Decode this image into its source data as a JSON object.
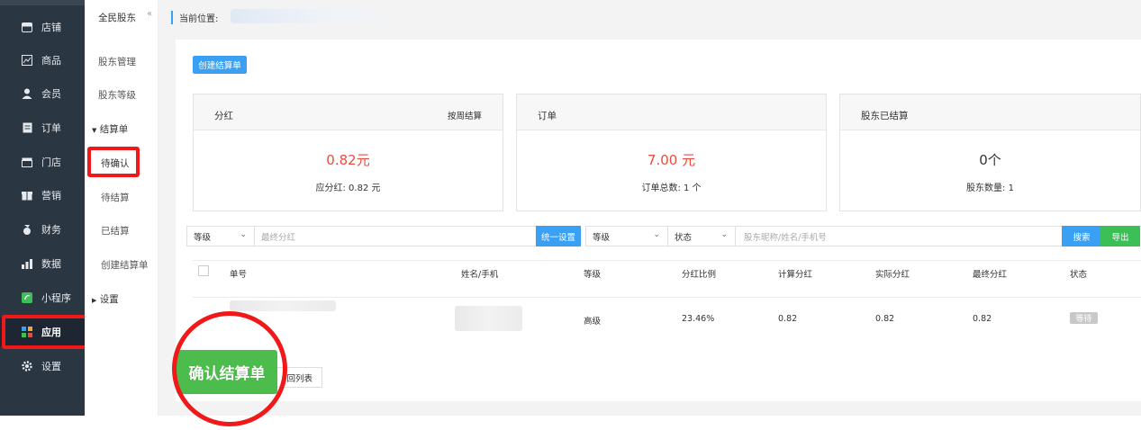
{
  "sidebar": {
    "items": [
      {
        "label": "店铺",
        "icon": "store-icon"
      },
      {
        "label": "商品",
        "icon": "goods-icon"
      },
      {
        "label": "会员",
        "icon": "member-icon"
      },
      {
        "label": "订单",
        "icon": "order-icon"
      },
      {
        "label": "门店",
        "icon": "shop-icon"
      },
      {
        "label": "营销",
        "icon": "marketing-icon"
      },
      {
        "label": "财务",
        "icon": "finance-icon"
      },
      {
        "label": "数据",
        "icon": "data-icon"
      },
      {
        "label": "小程序",
        "icon": "miniprogram-icon"
      },
      {
        "label": "应用",
        "icon": "apps-icon"
      },
      {
        "label": "设置",
        "icon": "gear-icon"
      }
    ]
  },
  "subnav": {
    "title": "全民股东",
    "items": [
      "股东管理",
      "股东等级"
    ],
    "group_settlement": "结算单",
    "settlement_items": [
      "待确认",
      "待结算",
      "已结算",
      "创建结算单"
    ],
    "group_settings": "设置"
  },
  "breadcrumb": {
    "label": "当前位置:"
  },
  "create_button": "创建结算单",
  "cards": [
    {
      "title": "分红",
      "right": "按周结算",
      "big": "0.82元",
      "small": "应分红: 0.82 元",
      "big_color": "#e84c3d"
    },
    {
      "title": "订单",
      "right": "",
      "big": "7.00 元",
      "small": "订单总数: 1 个",
      "big_color": "#e84c3d"
    },
    {
      "title": "股东已结算",
      "right": "",
      "big": "0个",
      "small": "股东数量: 1",
      "big_color": "#333333"
    }
  ],
  "filters": {
    "level1": "等级",
    "final_dividend_placeholder": "最终分红",
    "unify_button": "统一设置",
    "level2": "等级",
    "status": "状态",
    "search_placeholder": "股东昵称/姓名/手机号",
    "search_button": "搜索",
    "export_button": "导出"
  },
  "table": {
    "headers": [
      "单号",
      "姓名/手机",
      "等级",
      "分红比例",
      "计算分红",
      "实际分红",
      "最终分红",
      "状态"
    ],
    "rows": [
      {
        "level": "高级",
        "ratio": "23.46%",
        "calc": "0.82",
        "actual": "0.82",
        "final": "0.82",
        "status": "等待"
      }
    ]
  },
  "back_button": "回列表",
  "confirm_button": "确认结算单",
  "colors": {
    "accent": "#3aa0f3",
    "green": "#3cbf56",
    "red": "#e84c3d",
    "sidebar": "#2b3643"
  }
}
